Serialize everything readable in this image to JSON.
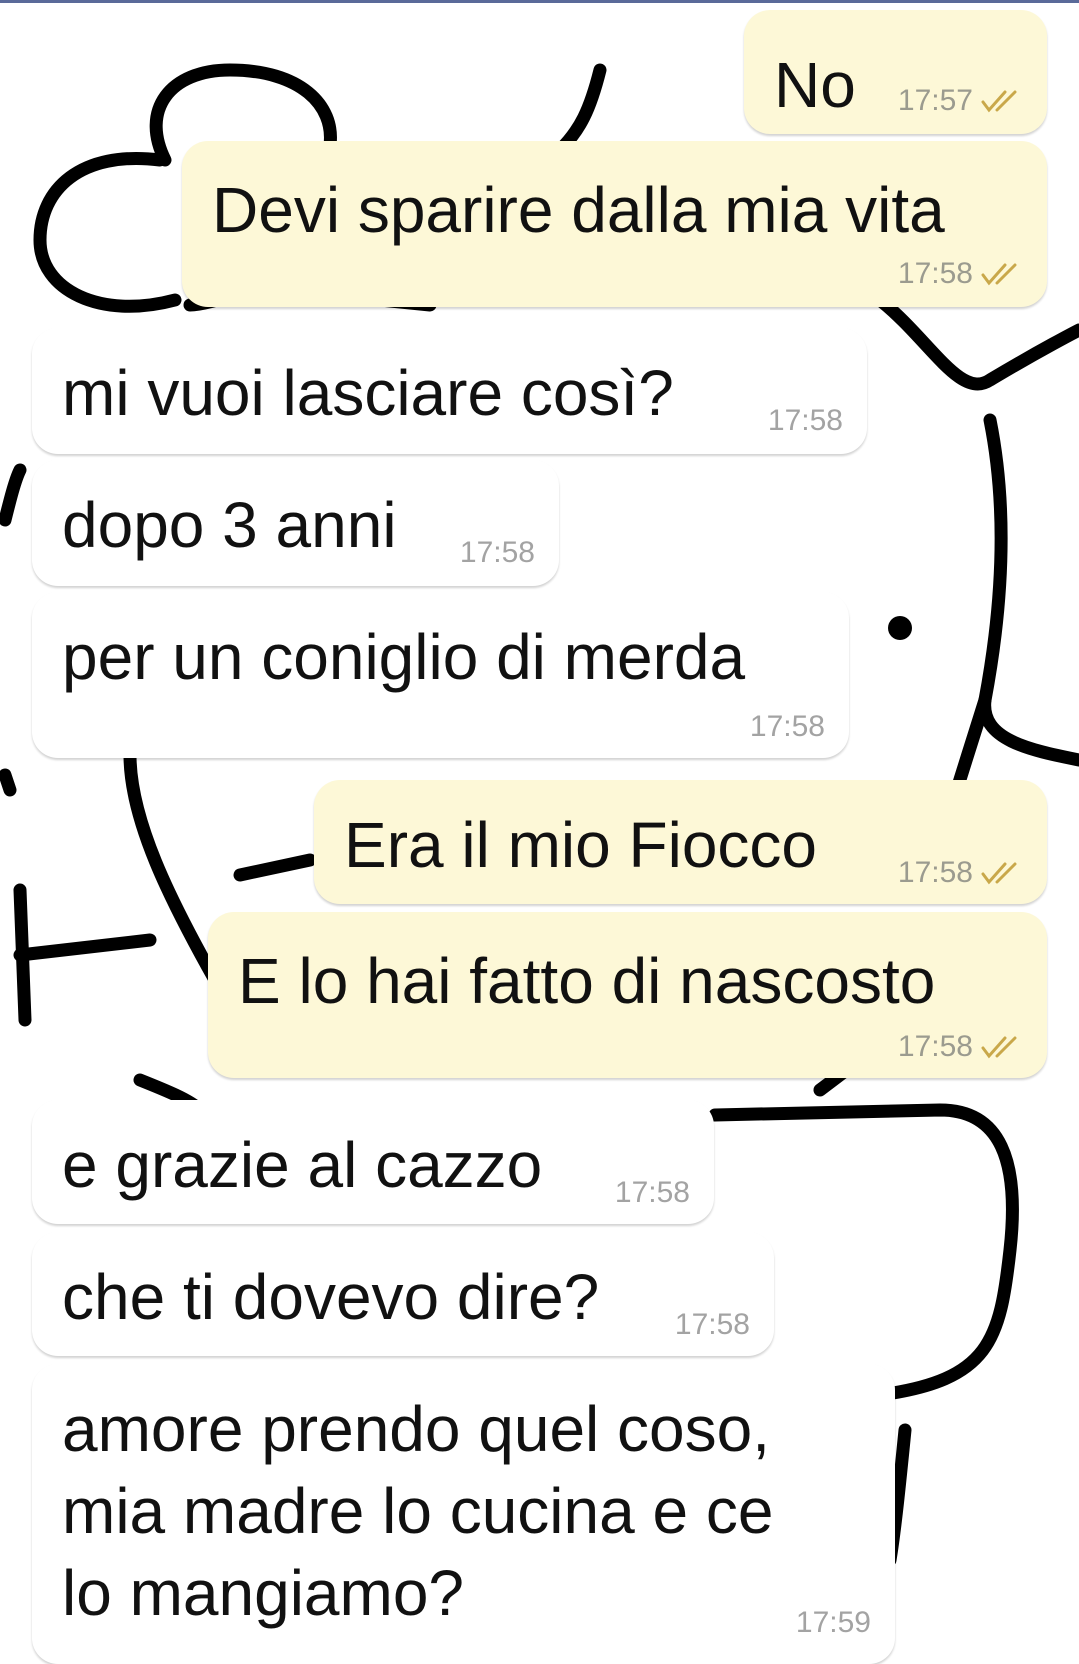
{
  "colors": {
    "outgoing_bubble": "#fdf8d7",
    "incoming_bubble": "#ffffff",
    "tick_color": "#c9a84a",
    "timestamp": "#9b9b8f"
  },
  "messages": [
    {
      "direction": "outgoing",
      "text": "No",
      "time": "17:57",
      "status_icon": "double-check-icon"
    },
    {
      "direction": "outgoing",
      "text": "Devi sparire dalla mia vita",
      "time": "17:58",
      "status_icon": "double-check-icon"
    },
    {
      "direction": "incoming",
      "text": "mi vuoi lasciare così?",
      "time": "17:58"
    },
    {
      "direction": "incoming",
      "text": "dopo 3 anni",
      "time": "17:58"
    },
    {
      "direction": "incoming",
      "text": "per un coniglio di merda",
      "time": "17:58"
    },
    {
      "direction": "outgoing",
      "text": "Era il mio Fiocco",
      "time": "17:58",
      "status_icon": "double-check-icon"
    },
    {
      "direction": "outgoing",
      "text": "E lo hai fatto di nascosto",
      "time": "17:58",
      "status_icon": "double-check-icon"
    },
    {
      "direction": "incoming",
      "text": "e grazie al cazzo",
      "time": "17:58"
    },
    {
      "direction": "incoming",
      "text": "che ti dovevo dire?",
      "time": "17:58"
    },
    {
      "direction": "incoming",
      "text_lines": [
        "amore prendo quel coso,",
        "mia madre lo cucina e ce",
        "lo mangiamo?"
      ],
      "time": "17:59"
    }
  ]
}
